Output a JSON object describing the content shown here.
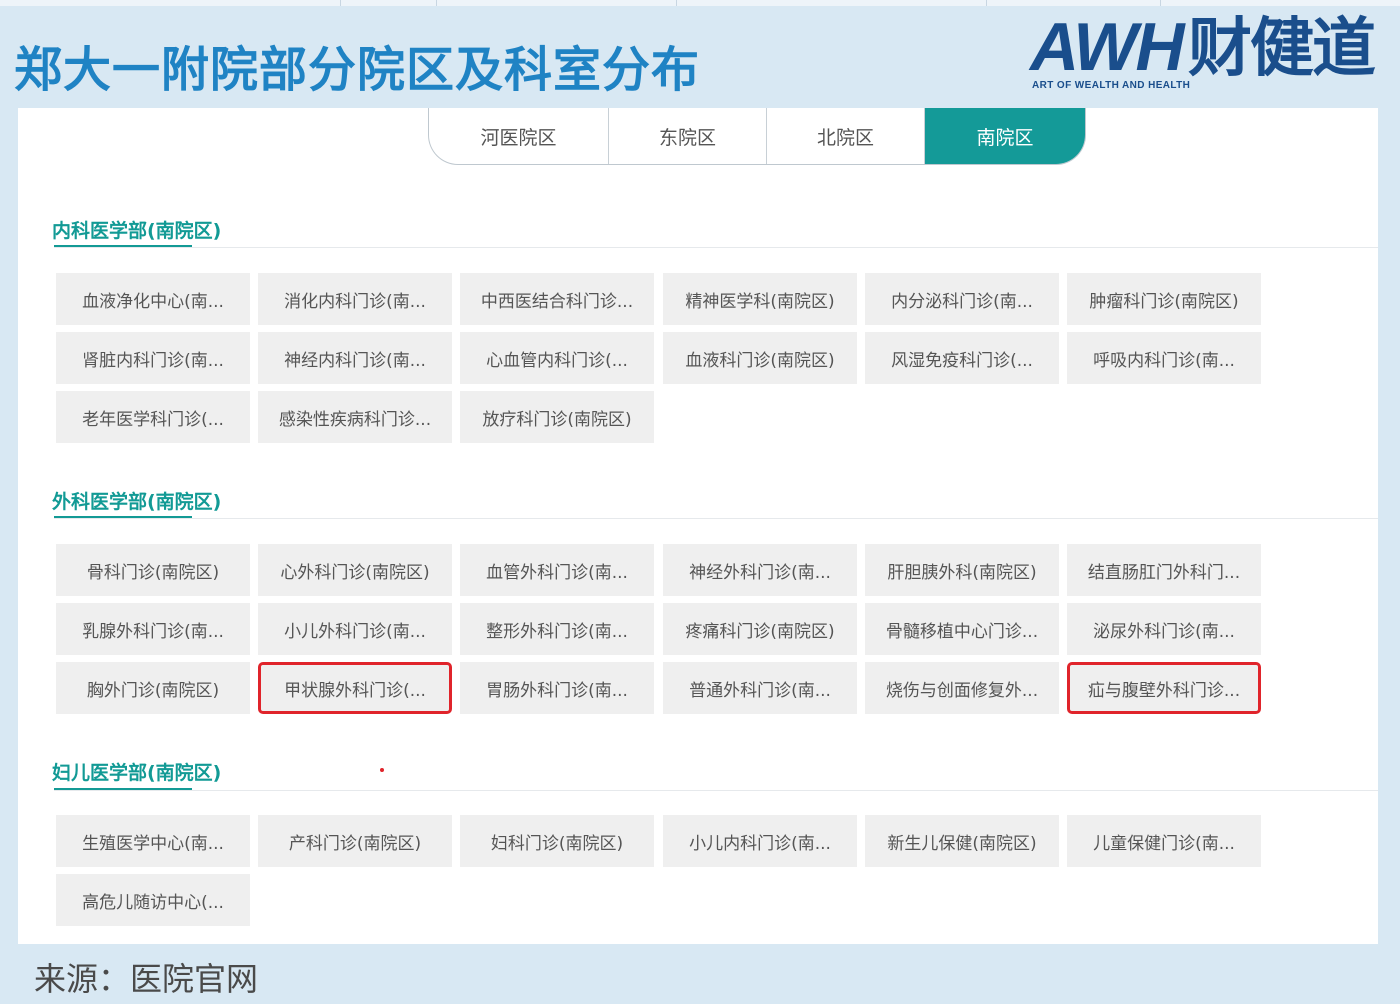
{
  "title": "郑大一附院部分院区及科室分布",
  "logo": {
    "brand": "AWH",
    "cn": "财健道",
    "subtitle": "ART OF WEALTH AND HEALTH"
  },
  "tabs": [
    {
      "label": "河医院区",
      "active": false
    },
    {
      "label": "东院区",
      "active": false
    },
    {
      "label": "北院区",
      "active": false
    },
    {
      "label": "南院区",
      "active": true
    }
  ],
  "sections": [
    {
      "title": "内科医学部(南院区)",
      "items": [
        {
          "label": "血液净化中心(南..."
        },
        {
          "label": "消化内科门诊(南..."
        },
        {
          "label": "中西医结合科门诊..."
        },
        {
          "label": "精神医学科(南院区)"
        },
        {
          "label": "内分泌科门诊(南..."
        },
        {
          "label": "肿瘤科门诊(南院区)"
        },
        {
          "label": "肾脏内科门诊(南..."
        },
        {
          "label": "神经内科门诊(南..."
        },
        {
          "label": "心血管内科门诊(..."
        },
        {
          "label": "血液科门诊(南院区)"
        },
        {
          "label": "风湿免疫科门诊(..."
        },
        {
          "label": "呼吸内科门诊(南..."
        },
        {
          "label": "老年医学科门诊(..."
        },
        {
          "label": "感染性疾病科门诊..."
        },
        {
          "label": "放疗科门诊(南院区)"
        }
      ]
    },
    {
      "title": "外科医学部(南院区)",
      "items": [
        {
          "label": "骨科门诊(南院区)"
        },
        {
          "label": "心外科门诊(南院区)"
        },
        {
          "label": "血管外科门诊(南..."
        },
        {
          "label": "神经外科门诊(南..."
        },
        {
          "label": "肝胆胰外科(南院区)"
        },
        {
          "label": "结直肠肛门外科门..."
        },
        {
          "label": "乳腺外科门诊(南..."
        },
        {
          "label": "小儿外科门诊(南..."
        },
        {
          "label": "整形外科门诊(南..."
        },
        {
          "label": "疼痛科门诊(南院区)"
        },
        {
          "label": "骨髓移植中心门诊..."
        },
        {
          "label": "泌尿外科门诊(南..."
        },
        {
          "label": "胸外门诊(南院区)"
        },
        {
          "label": "甲状腺外科门诊(...",
          "highlight": true
        },
        {
          "label": "胃肠外科门诊(南..."
        },
        {
          "label": "普通外科门诊(南..."
        },
        {
          "label": "烧伤与创面修复外..."
        },
        {
          "label": "疝与腹壁外科门诊...",
          "highlight": true
        }
      ]
    },
    {
      "title": "妇儿医学部(南院区)",
      "items": [
        {
          "label": "生殖医学中心(南..."
        },
        {
          "label": "产科门诊(南院区)"
        },
        {
          "label": "妇科门诊(南院区)"
        },
        {
          "label": "小儿内科门诊(南..."
        },
        {
          "label": "新生儿保健(南院区)"
        },
        {
          "label": "儿童保健门诊(南..."
        },
        {
          "label": "高危儿随访中心(..."
        }
      ]
    }
  ],
  "source": "来源：医院官网",
  "colors": {
    "accent": "#149a98",
    "title": "#1f83c4",
    "highlight": "#e0242b",
    "background": "#d8e8f3"
  }
}
